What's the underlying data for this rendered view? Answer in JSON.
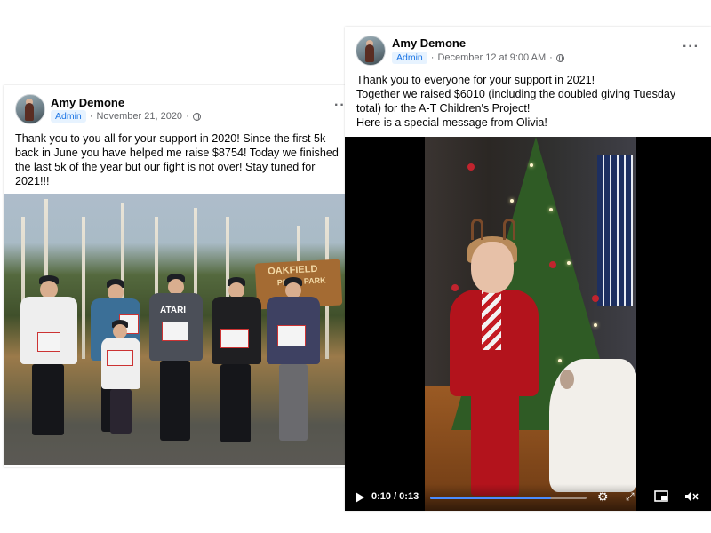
{
  "left_post": {
    "author": "Amy Demone",
    "badge": "Admin",
    "date": "November 21, 2020",
    "separator": "·",
    "more": "··",
    "text_lines": [
      "Thank you to you all for your support in 2020! Since the first 5k",
      "back in June you have helped me raise  $8754! Today we finished",
      "the last 5k of the year but our fight is not over! Stay tuned for",
      "2021!!!"
    ],
    "photo": {
      "sign_lines": [
        "OAKFIELD",
        "PROV",
        "PARK"
      ],
      "shirt_text": "ATARI"
    }
  },
  "right_post": {
    "author": "Amy Demone",
    "badge": "Admin",
    "date": "December 12 at 9:00 AM",
    "separator": "·",
    "more": "···",
    "text_lines": [
      "Thank you to everyone for your support in 2021!",
      "Together we raised $6010 (including the doubled giving Tuesday",
      "total) for the A-T Children's Project!",
      "Here is a special message from Olivia!"
    ],
    "video": {
      "current_time": "0:10",
      "duration": "0:13",
      "time_display": "0:10 / 0:13",
      "progress": 0.77
    }
  },
  "colors": {
    "badge_bg": "#e7f3ff",
    "badge_text": "#1b74e4",
    "progress": "#4a8cff"
  },
  "icons": [
    "globe-icon",
    "more-options-icon",
    "play-icon",
    "settings-icon",
    "fullscreen-icon",
    "picture-in-picture-icon",
    "mute-icon"
  ]
}
